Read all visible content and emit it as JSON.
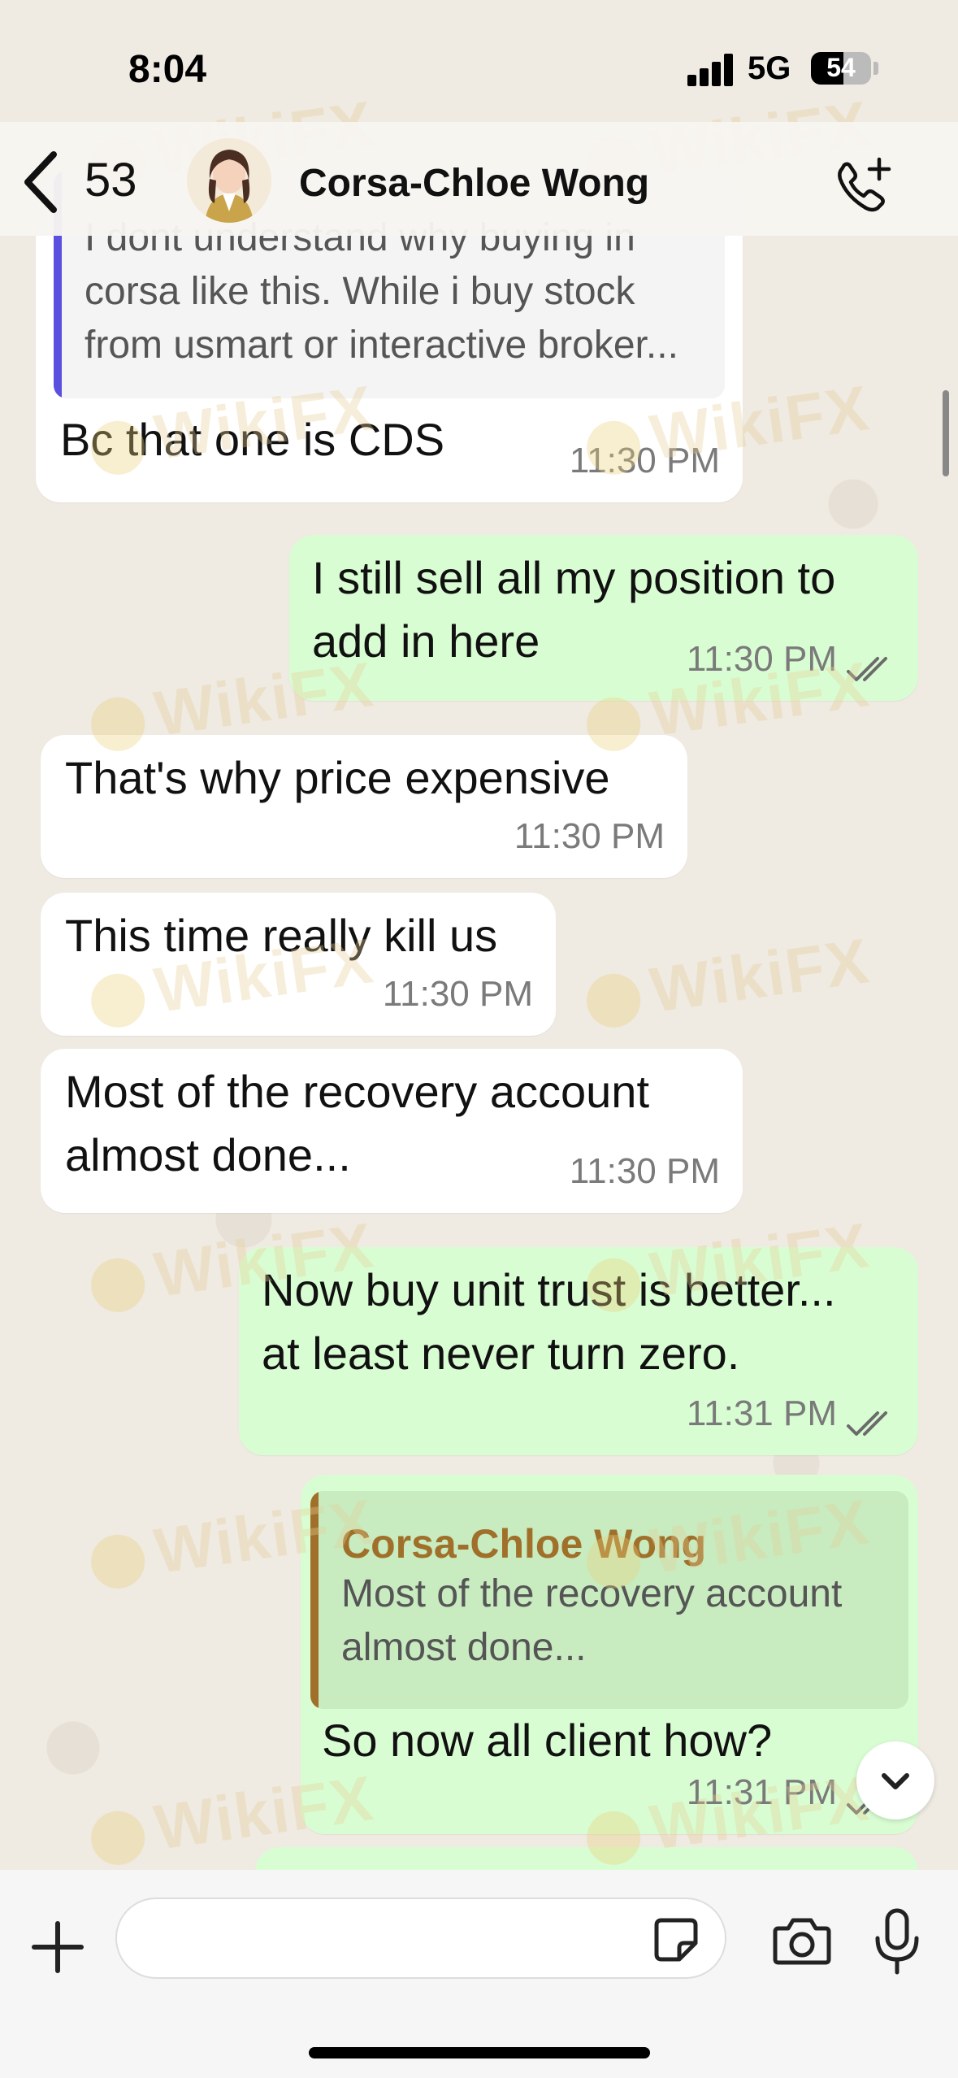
{
  "status": {
    "time": "8:04",
    "network": "5G",
    "battery": "54",
    "battery_level": 0.54
  },
  "header": {
    "back_count": "53",
    "contact_name": "Corsa-Chloe Wong"
  },
  "messages": [
    {
      "quote_text": "I dont understand why buying in\ncorsa like this. While i buy stock\nfrom usmart or interactive broker...",
      "text": "Bc that one is CDS",
      "time": "11:30 PM"
    },
    {
      "text": "I still sell all my position to\nadd in here",
      "time": "11:30 PM"
    },
    {
      "text": "That's why price expensive",
      "time": "11:30 PM"
    },
    {
      "text": "This time really kill us",
      "time": "11:30 PM"
    },
    {
      "text": "Most of the recovery account\nalmost done...",
      "time": "11:30 PM"
    },
    {
      "text": "Now buy unit trust is better...\nat least never turn zero.",
      "time": "11:31 PM"
    },
    {
      "quote_author": "Corsa-Chloe Wong",
      "quote_text": "Most of the recovery account\nalmost done...",
      "text": "So now all client how?",
      "time": "11:31 PM"
    }
  ],
  "watermark": "WikiFX",
  "colors": {
    "outgoing": "#d9fdd3",
    "incoming": "#ffffff",
    "quote_bar_incoming": "#5b4fe0",
    "quote_bar_outgoing": "#a0702a",
    "quote_author": "#a0702a"
  }
}
